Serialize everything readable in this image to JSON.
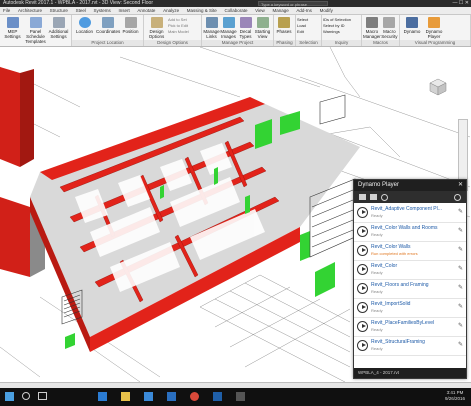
{
  "window": {
    "title": "Autodesk Revit 2017.1 -   WPBLA - 2017.rvt - 3D View: Second Floor",
    "search_placeholder": "Type a keyword or phrase"
  },
  "ribbon_tabs": [
    "File",
    "Architecture",
    "Structure",
    "Steel",
    "Systems",
    "Insert",
    "Annotate",
    "Analyze",
    "Massing & Site",
    "Collaborate",
    "View",
    "Manage",
    "Add-Ins",
    "Modify"
  ],
  "ribbon": {
    "groups": [
      {
        "buttons": [
          "MEP Settings",
          "Panel Schedule Templates",
          "Additional Settings"
        ],
        "label": ""
      },
      {
        "buttons": [
          "Location",
          "Coordinates",
          "Position"
        ],
        "label": "Project Location"
      },
      {
        "buttons": [
          "Design Options"
        ],
        "small": [
          "Add to Set",
          "Pick to Edit",
          "Main Model"
        ],
        "label": "Design Options"
      },
      {
        "buttons": [
          "Manage Links",
          "Manage Images",
          "Decal Types",
          "Starting View"
        ],
        "label": "Manage Project"
      },
      {
        "buttons": [
          "Phases"
        ],
        "label": "Phasing"
      },
      {
        "buttons": [
          "Select",
          "Load",
          "Edit"
        ],
        "label": "Selection"
      },
      {
        "small": [
          "IDs of Selection",
          "Select by ID",
          "Warnings"
        ],
        "label": "Inquiry"
      },
      {
        "buttons": [
          "Macro Manager",
          "Macro Security"
        ],
        "label": "Macros"
      },
      {
        "buttons": [
          "Dynamo",
          "Dynamo Player"
        ],
        "label": "Visual Programming"
      }
    ]
  },
  "dynamo_player": {
    "title": "Dynamo Player",
    "scripts": [
      {
        "name": "Revit_Adaptive Component Pl...",
        "status": "Ready"
      },
      {
        "name": "Revit_Color Walls and Rooms",
        "status": "Ready"
      },
      {
        "name": "Revit_Color Walls",
        "status": "Run completed with errors"
      },
      {
        "name": "Revit_Color",
        "status": "Ready"
      },
      {
        "name": "Revit_Floors and Framing",
        "status": "Ready"
      },
      {
        "name": "Revit_ImportSolid",
        "status": "Ready"
      },
      {
        "name": "Revit_PlaceFamiliesByLevel",
        "status": "Ready"
      },
      {
        "name": "Revit_StructuralFraming",
        "status": "Ready"
      }
    ],
    "footer": "WPBLA_4 - 2017.rvt"
  },
  "clock": {
    "time": "3:41 PM",
    "date": "9/26/2016"
  },
  "colors": {
    "wall_red": "#e2231a",
    "glass_green": "#33d333",
    "ribbon_bg": "#f4f4f4",
    "taskbar": "#101010"
  }
}
